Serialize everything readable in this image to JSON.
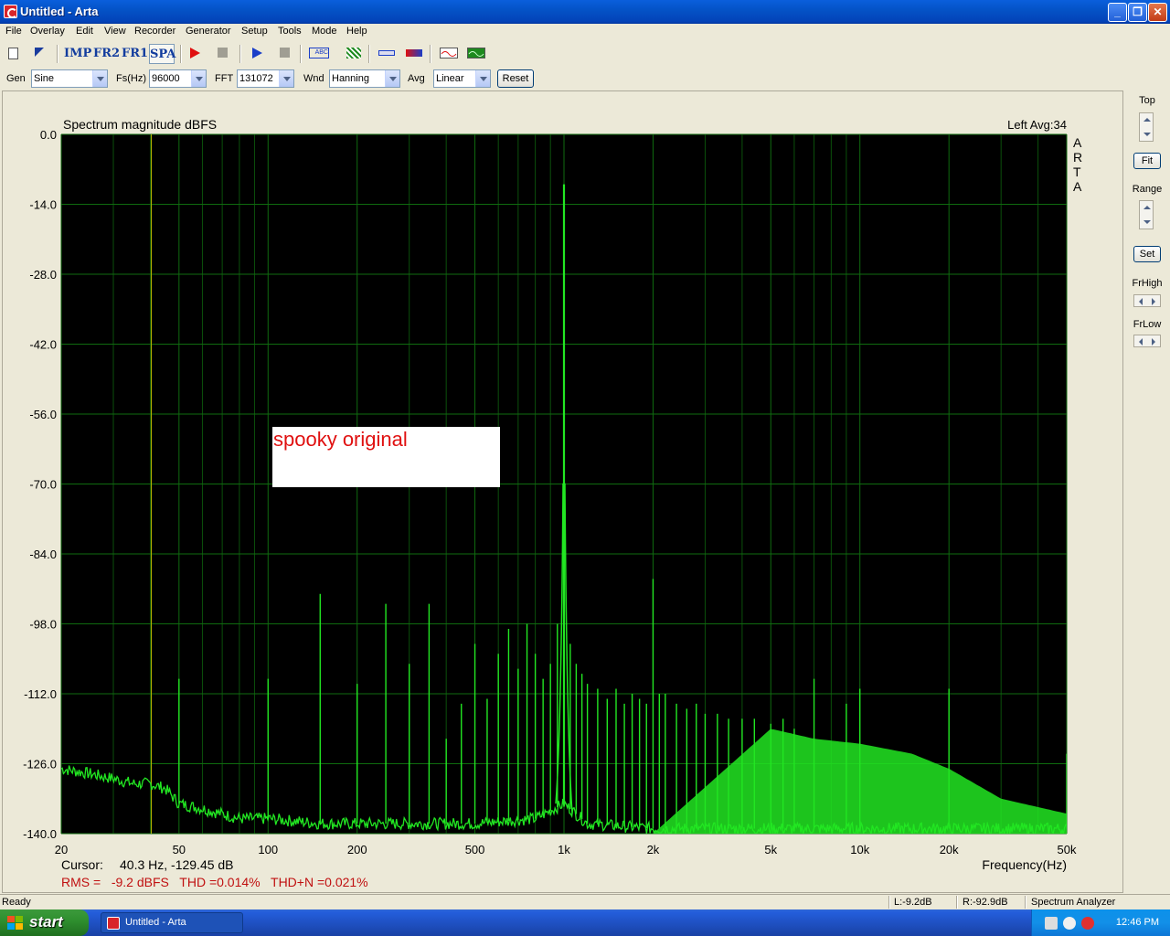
{
  "window": {
    "title": "Untitled - Arta"
  },
  "menu": [
    "File",
    "Overlay",
    "Edit",
    "View",
    "Recorder",
    "Generator",
    "Setup",
    "Tools",
    "Mode",
    "Help"
  ],
  "toolbar": {
    "imp": "IMP",
    "fr2": "FR2",
    "fr1": "FR1",
    "spa": "SPA",
    "icons": [
      "new-file-icon",
      "open-icon",
      "record-red-icon",
      "stop-icon",
      "play-blue-icon",
      "stop2-icon",
      "abc-icon",
      "pattern-icon",
      "slider-icon",
      "colorbar-icon",
      "scope-red-icon",
      "scope-green-icon"
    ]
  },
  "settings": {
    "gen_label": "Gen",
    "gen_value": "Sine",
    "fs_label": "Fs(Hz)",
    "fs_value": "96000",
    "fft_label": "FFT",
    "fft_value": "131072",
    "wnd_label": "Wnd",
    "wnd_value": "Hanning",
    "avg_label": "Avg",
    "avg_value": "Linear",
    "reset": "Reset"
  },
  "right_panel": {
    "top": "Top",
    "fit": "Fit",
    "range": "Range",
    "set": "Set",
    "frhigh": "FrHigh",
    "frlow": "FrLow"
  },
  "chart_data": {
    "type": "line",
    "title": "Spectrum magnitude dBFS",
    "channel_info": "Left  Avg:34",
    "side_label": [
      "A",
      "R",
      "T",
      "A"
    ],
    "xlabel": "Frequency(Hz)",
    "x_scale": "log",
    "xlim": [
      20,
      50000
    ],
    "ylim": [
      -140,
      0
    ],
    "x_ticks": [
      20,
      50,
      100,
      200,
      500,
      1000,
      2000,
      5000,
      10000,
      20000,
      50000
    ],
    "x_tick_labels": [
      "20",
      "50",
      "100",
      "200",
      "500",
      "1k",
      "2k",
      "5k",
      "10k",
      "20k",
      "50k"
    ],
    "y_ticks": [
      0,
      -14,
      -28,
      -42,
      -56,
      -70,
      -84,
      -98,
      -112,
      -126,
      -140
    ],
    "y_tick_labels": [
      "0.0",
      "-14.0",
      "-28.0",
      "-42.0",
      "-56.0",
      "-70.0",
      "-84.0",
      "-98.0",
      "-112.0",
      "-126.0",
      "-140.0"
    ],
    "grid": true,
    "colors": {
      "background": "#000000",
      "grid": "#0f6b0f",
      "trace": "#22e622",
      "cursor": "#b5b500"
    },
    "cursor_x": 40.3,
    "annotation": "spooky original",
    "series": [
      {
        "noise_floor": [
          [
            20,
            -127
          ],
          [
            25,
            -128
          ],
          [
            30,
            -129
          ],
          [
            35,
            -130
          ],
          [
            40,
            -130
          ],
          [
            45,
            -131
          ],
          [
            50,
            -134
          ],
          [
            60,
            -135
          ],
          [
            80,
            -137
          ],
          [
            100,
            -137
          ],
          [
            150,
            -138
          ],
          [
            200,
            -138
          ],
          [
            300,
            -138
          ],
          [
            500,
            -138
          ],
          [
            800,
            -137
          ],
          [
            1000,
            -134
          ],
          [
            1200,
            -138
          ],
          [
            2000,
            -139
          ],
          [
            5000,
            -139
          ],
          [
            10000,
            -139
          ],
          [
            20000,
            -139
          ],
          [
            50000,
            -139
          ]
        ],
        "peaks": [
          [
            50,
            -109
          ],
          [
            100,
            -109
          ],
          [
            150,
            -92
          ],
          [
            200,
            -110
          ],
          [
            250,
            -94
          ],
          [
            300,
            -106
          ],
          [
            350,
            -94
          ],
          [
            400,
            -121
          ],
          [
            450,
            -114
          ],
          [
            500,
            -102
          ],
          [
            550,
            -113
          ],
          [
            600,
            -104
          ],
          [
            650,
            -99
          ],
          [
            700,
            -107
          ],
          [
            750,
            -98
          ],
          [
            800,
            -104
          ],
          [
            850,
            -109
          ],
          [
            900,
            -106
          ],
          [
            950,
            -98
          ],
          [
            1000,
            -10
          ],
          [
            1050,
            -102
          ],
          [
            1100,
            -106
          ],
          [
            1150,
            -108
          ],
          [
            1200,
            -110
          ],
          [
            1300,
            -111
          ],
          [
            1400,
            -113
          ],
          [
            1500,
            -111
          ],
          [
            1600,
            -114
          ],
          [
            1700,
            -112
          ],
          [
            1800,
            -113
          ],
          [
            1900,
            -114
          ],
          [
            2000,
            -89
          ],
          [
            2100,
            -112
          ],
          [
            2200,
            -112
          ],
          [
            2400,
            -114
          ],
          [
            2600,
            -115
          ],
          [
            2800,
            -114
          ],
          [
            3000,
            -116
          ],
          [
            3300,
            -116
          ],
          [
            3600,
            -117
          ],
          [
            4000,
            -117
          ],
          [
            4400,
            -117
          ],
          [
            5000,
            -118
          ],
          [
            5500,
            -117
          ],
          [
            6000,
            -119
          ],
          [
            7000,
            -109
          ],
          [
            9000,
            -114
          ],
          [
            10000,
            -111
          ],
          [
            20000,
            -111
          ],
          [
            50000,
            -124
          ]
        ],
        "dense_band_floor": [
          [
            2000,
            -140
          ],
          [
            5000,
            -119
          ],
          [
            7000,
            -121
          ],
          [
            10000,
            -122
          ],
          [
            15000,
            -124
          ],
          [
            20000,
            -127
          ],
          [
            30000,
            -133
          ],
          [
            50000,
            -136
          ]
        ]
      }
    ]
  },
  "readouts": {
    "cursor_label": "Cursor:",
    "cursor_value": "40.3 Hz, -129.45 dB",
    "rms": "RMS =   -9.2 dBFS   THD =0.014%   THD+N =0.021%"
  },
  "status": {
    "left": "Ready",
    "l": "L:-9.2dB",
    "r": "R:-92.9dB",
    "mode": "Spectrum Analyzer"
  },
  "taskbar": {
    "start": "start",
    "app": "Untitled - Arta",
    "clock": "12:46 PM"
  }
}
